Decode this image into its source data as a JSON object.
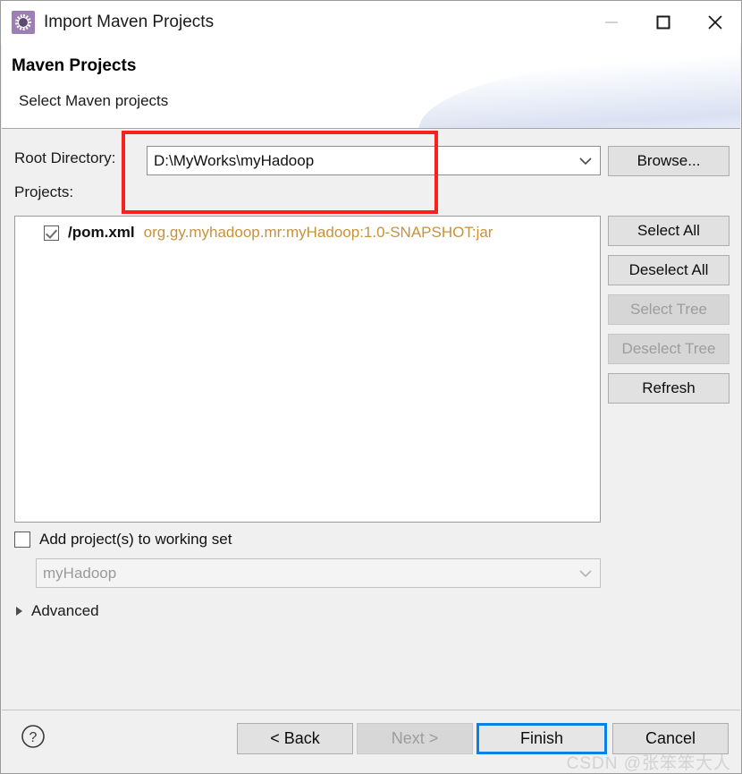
{
  "window": {
    "title": "Import Maven Projects",
    "icon": "maven-gear-icon",
    "minimize_label": "—",
    "maximize_label": "□",
    "close_label": "✕"
  },
  "header": {
    "title": "Maven Projects",
    "subtitle": "Select Maven projects"
  },
  "form": {
    "root_directory_label": "Root Directory:",
    "root_directory_value": "D:\\MyWorks\\myHadoop",
    "root_directory_placeholder": "",
    "browse_label": "Browse...",
    "projects_label": "Projects:"
  },
  "projects": {
    "rows": [
      {
        "checked": true,
        "name": "/pom.xml",
        "coordinates": "org.gy.myhadoop.mr:myHadoop:1.0-SNAPSHOT:jar"
      }
    ]
  },
  "side_buttons": [
    {
      "label": "Select All",
      "enabled": true
    },
    {
      "label": "Deselect All",
      "enabled": true
    },
    {
      "label": "Select Tree",
      "enabled": false
    },
    {
      "label": "Deselect Tree",
      "enabled": false
    },
    {
      "label": "Refresh",
      "enabled": true
    }
  ],
  "working_set": {
    "checkbox_label": "Add project(s) to working set",
    "checked": false,
    "value": "myHadoop"
  },
  "advanced": {
    "label": "Advanced",
    "expanded": false
  },
  "footer": {
    "help_label": "?",
    "back_label": "< Back",
    "next_label": "Next >",
    "finish_label": "Finish",
    "cancel_label": "Cancel",
    "watermark": "CSDN @张笨笨大人"
  },
  "colors": {
    "accent": "#0a81e8",
    "annotation": "#fb2020",
    "coordinates_text": "#c8913c",
    "icon_purple": "#9b7fb5",
    "dialog_face": "#f0f0f0"
  }
}
